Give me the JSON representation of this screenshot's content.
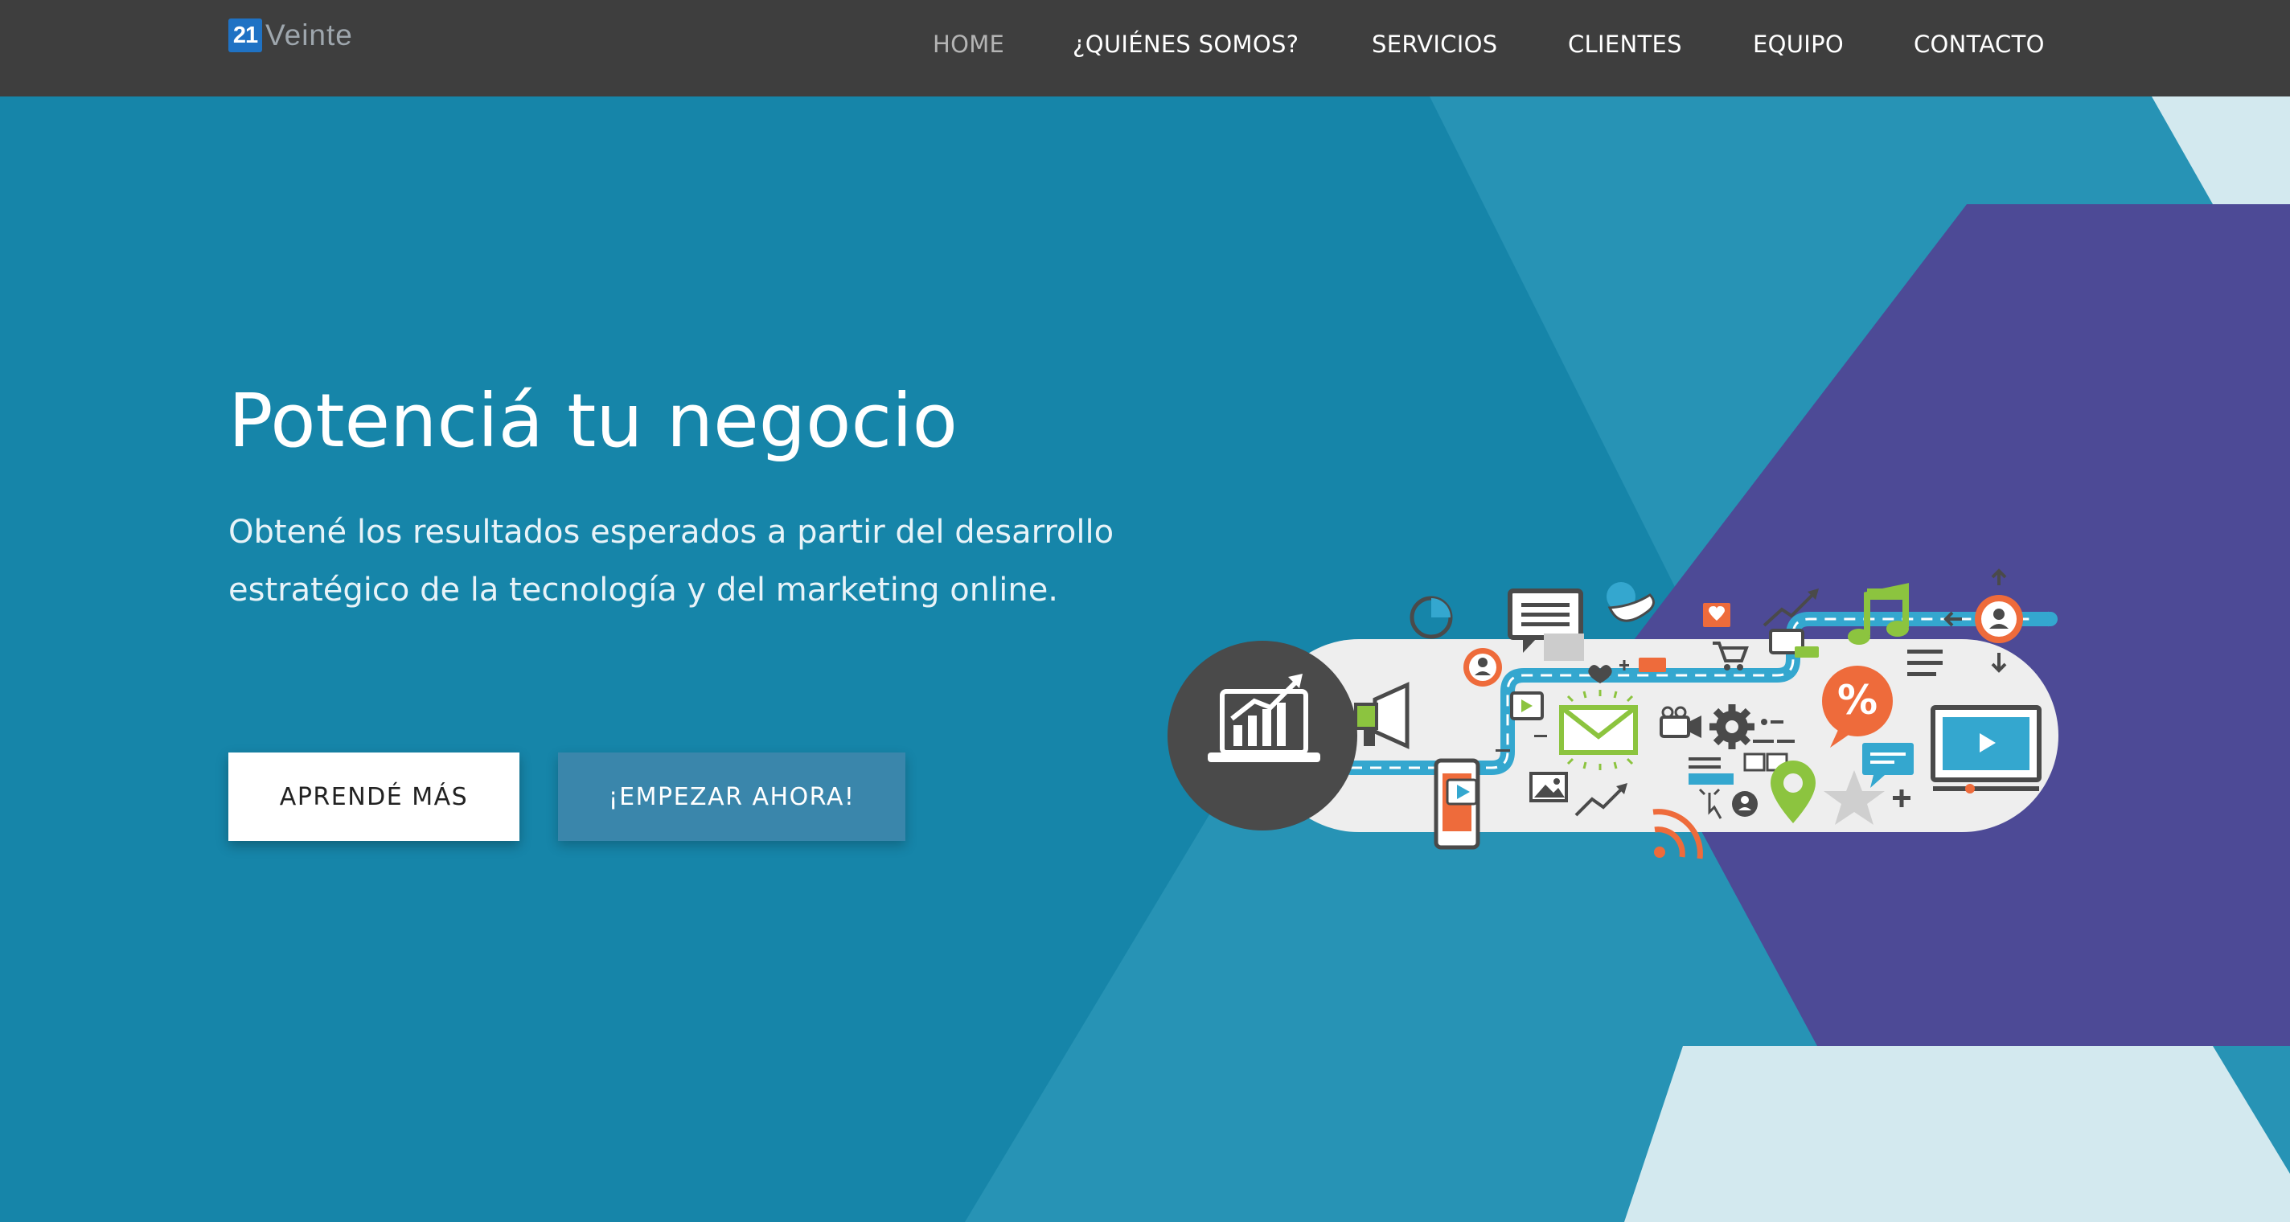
{
  "brand": {
    "logo_number": "21",
    "logo_word": "Veinte"
  },
  "nav": {
    "items": [
      {
        "label": "HOME",
        "active": true
      },
      {
        "label": "¿QUIÉNES SOMOS?",
        "active": false
      },
      {
        "label": "SERVICIOS",
        "active": false
      },
      {
        "label": "CLIENTES",
        "active": false
      },
      {
        "label": "EQUIPO",
        "active": false
      },
      {
        "label": "CONTACTO",
        "active": false
      }
    ]
  },
  "hero": {
    "title": "Potenciá tu negocio",
    "subtitle_line1": "Obtené los resultados esperados a partir del desarrollo",
    "subtitle_line2": "estratégico de la tecnología y del marketing online.",
    "primary_button": "APRENDÉ MÁS",
    "secondary_button": "¡EMPEZAR AHORA!",
    "illustration_badge": "%"
  },
  "colors": {
    "navbar": "#3e3e3e",
    "hero_blue": "#1685a9",
    "hero_blue_light": "#2793b5",
    "purple": "#4d4a96",
    "pale": "#d3e9ef",
    "orange": "#ee6b3b",
    "green": "#8cc43f",
    "cyan": "#34a7cf",
    "dark_gray": "#4a4a4a",
    "button_secondary": "#3a86ab"
  },
  "icons": [
    "laptop-chart-icon",
    "megaphone-icon",
    "chat-bubble-icon",
    "bird-icon",
    "user-icon",
    "music-note-icon",
    "percent-icon",
    "envelope-icon",
    "gear-icon",
    "video-camera-icon",
    "rss-icon",
    "location-pin-icon",
    "star-icon",
    "monitor-play-icon",
    "smartphone-icon",
    "cart-icon",
    "heart-icon",
    "pie-chart-icon",
    "image-icon",
    "trend-arrow-icon"
  ]
}
